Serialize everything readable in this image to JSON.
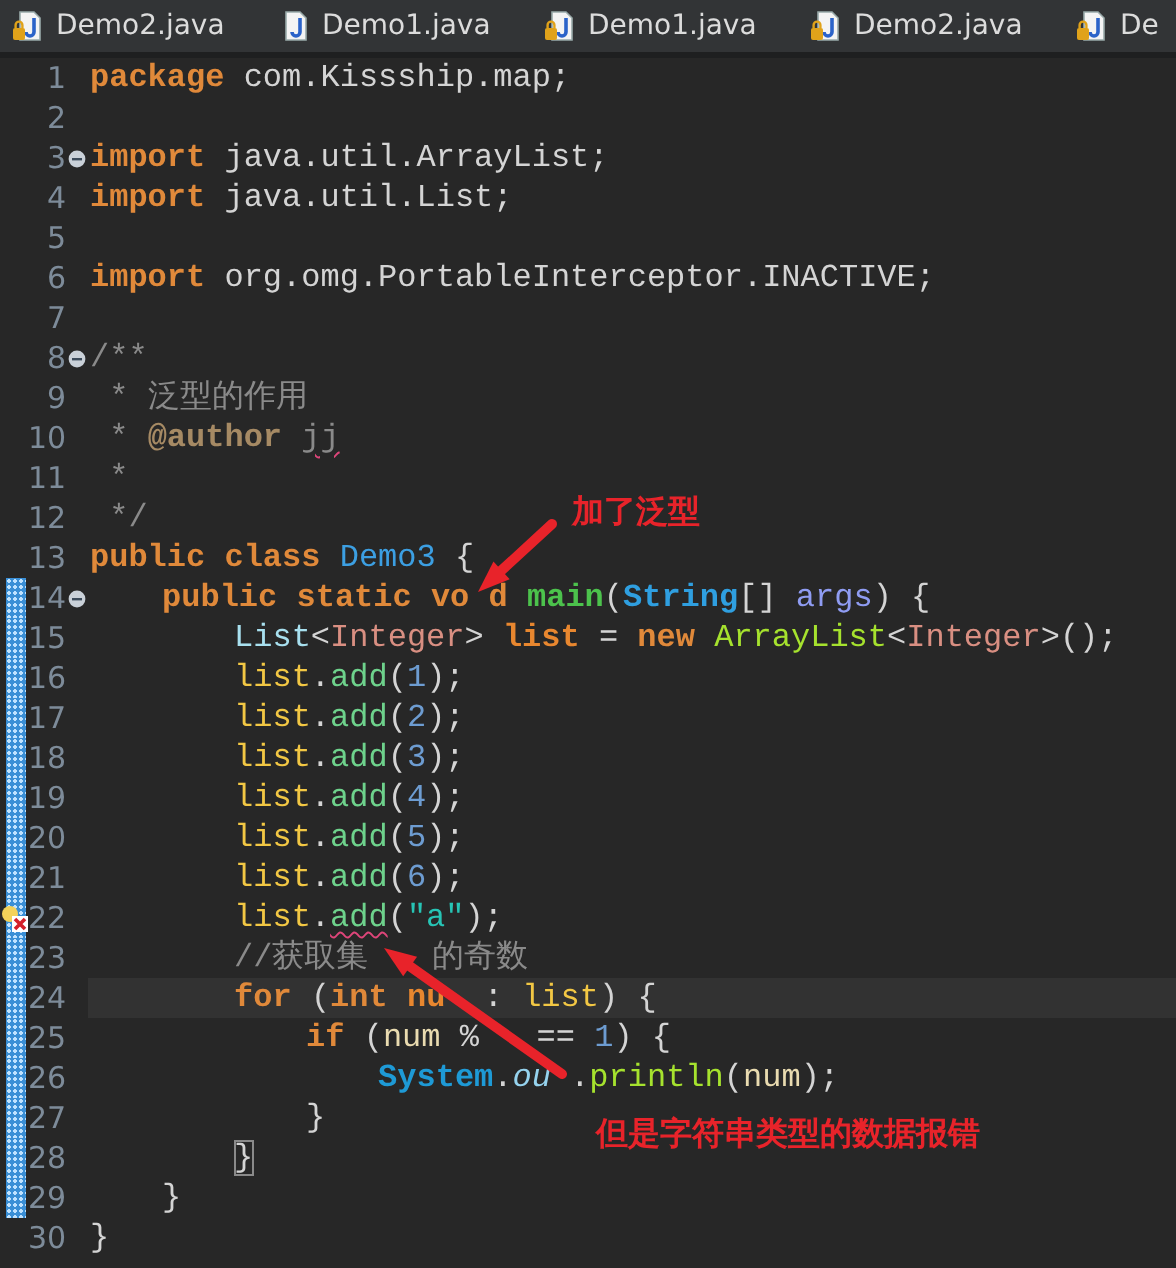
{
  "tabs": [
    {
      "label": "Demo2.java",
      "locked": true
    },
    {
      "label": "Demo1.java",
      "locked": false
    },
    {
      "label": "Demo1.java",
      "locked": true
    },
    {
      "label": "Demo2.java",
      "locked": true
    },
    {
      "label": "De",
      "locked": true
    }
  ],
  "editor": {
    "lines": [
      {
        "number": "1",
        "tokens": [
          {
            "kind": "keyword",
            "text": "package"
          },
          {
            "kind": "plain",
            "text": " com.Kissship.map;"
          }
        ]
      },
      {
        "number": "2"
      },
      {
        "number": "3",
        "fold": true,
        "tokens": [
          {
            "kind": "keyword",
            "text": "import"
          },
          {
            "kind": "plain",
            "text": " java.util.ArrayList;"
          }
        ]
      },
      {
        "number": "4",
        "tokens": [
          {
            "kind": "keyword",
            "text": "import"
          },
          {
            "kind": "plain",
            "text": " java.util.List;"
          }
        ]
      },
      {
        "number": "5"
      },
      {
        "number": "6",
        "tokens": [
          {
            "kind": "keyword",
            "text": "import"
          },
          {
            "kind": "plain",
            "text": " org.omg.PortableInterceptor.INACTIVE;"
          }
        ]
      },
      {
        "number": "7"
      },
      {
        "number": "8",
        "fold": true,
        "tokens": [
          {
            "kind": "doc",
            "text": "/**"
          }
        ]
      },
      {
        "number": "9",
        "tokens": [
          {
            "kind": "doc",
            "text": " * 泛型的作用"
          }
        ]
      },
      {
        "number": "10",
        "tokens": [
          {
            "kind": "doc",
            "text": " * "
          },
          {
            "kind": "doctag",
            "text": "@author "
          },
          {
            "kind": "doc",
            "text": "jj",
            "squiggle": true
          }
        ]
      },
      {
        "number": "11",
        "tokens": [
          {
            "kind": "doc",
            "text": " *"
          }
        ]
      },
      {
        "number": "12",
        "tokens": [
          {
            "kind": "doc",
            "text": " */"
          }
        ]
      },
      {
        "number": "13",
        "tokens": [
          {
            "kind": "keyword",
            "text": "public"
          },
          {
            "kind": "keyword",
            "text": " class"
          },
          {
            "kind": "class",
            "text": " Demo3"
          },
          {
            "kind": "plain",
            "text": " {"
          }
        ]
      },
      {
        "number": "14",
        "fold": true,
        "changed": true,
        "tokens": [
          {
            "kind": "keyword",
            "text": "\tpublic"
          },
          {
            "kind": "keyword",
            "text": " static"
          },
          {
            "kind": "keyword",
            "text": " vo"
          },
          {
            "kind": "keyword",
            "text": " d"
          },
          {
            "kind": "method-decl",
            "text": " main"
          },
          {
            "kind": "plain",
            "text": "("
          },
          {
            "kind": "type",
            "text": "String"
          },
          {
            "kind": "plain",
            "text": "[] "
          },
          {
            "kind": "param",
            "text": "args"
          },
          {
            "kind": "plain",
            "text": ") {"
          }
        ]
      },
      {
        "number": "15",
        "changed": true,
        "tokens": [
          {
            "kind": "interface",
            "text": "\t\tList"
          },
          {
            "kind": "plain",
            "text": "<"
          },
          {
            "kind": "generic",
            "text": "Integer"
          },
          {
            "kind": "plain",
            "text": "> "
          },
          {
            "kind": "local-decl",
            "text": "list"
          },
          {
            "kind": "plain",
            "text": " = "
          },
          {
            "kind": "keyword",
            "text": "new"
          },
          {
            "kind": "constructor",
            "text": " ArrayList"
          },
          {
            "kind": "plain",
            "text": "<"
          },
          {
            "kind": "generic",
            "text": "Integer"
          },
          {
            "kind": "plain",
            "text": ">();"
          }
        ]
      },
      {
        "number": "16",
        "changed": true,
        "tokens": [
          {
            "kind": "local",
            "text": "\t\tlist"
          },
          {
            "kind": "plain",
            "text": "."
          },
          {
            "kind": "method",
            "text": "add"
          },
          {
            "kind": "plain",
            "text": "("
          },
          {
            "kind": "number",
            "text": "1"
          },
          {
            "kind": "plain",
            "text": ");"
          }
        ]
      },
      {
        "number": "17",
        "changed": true,
        "tokens": [
          {
            "kind": "local",
            "text": "\t\tlist"
          },
          {
            "kind": "plain",
            "text": "."
          },
          {
            "kind": "method",
            "text": "add"
          },
          {
            "kind": "plain",
            "text": "("
          },
          {
            "kind": "number",
            "text": "2"
          },
          {
            "kind": "plain",
            "text": ");"
          }
        ]
      },
      {
        "number": "18",
        "changed": true,
        "tokens": [
          {
            "kind": "local",
            "text": "\t\tlist"
          },
          {
            "kind": "plain",
            "text": "."
          },
          {
            "kind": "method",
            "text": "add"
          },
          {
            "kind": "plain",
            "text": "("
          },
          {
            "kind": "number",
            "text": "3"
          },
          {
            "kind": "plain",
            "text": ");"
          }
        ]
      },
      {
        "number": "19",
        "changed": true,
        "tokens": [
          {
            "kind": "local",
            "text": "\t\tlist"
          },
          {
            "kind": "plain",
            "text": "."
          },
          {
            "kind": "method",
            "text": "add"
          },
          {
            "kind": "plain",
            "text": "("
          },
          {
            "kind": "number",
            "text": "4"
          },
          {
            "kind": "plain",
            "text": ");"
          }
        ]
      },
      {
        "number": "20",
        "changed": true,
        "tokens": [
          {
            "kind": "local",
            "text": "\t\tlist"
          },
          {
            "kind": "plain",
            "text": "."
          },
          {
            "kind": "method",
            "text": "add"
          },
          {
            "kind": "plain",
            "text": "("
          },
          {
            "kind": "number",
            "text": "5"
          },
          {
            "kind": "plain",
            "text": ");"
          }
        ]
      },
      {
        "number": "21",
        "changed": true,
        "tokens": [
          {
            "kind": "local",
            "text": "\t\tlist"
          },
          {
            "kind": "plain",
            "text": "."
          },
          {
            "kind": "method",
            "text": "add"
          },
          {
            "kind": "plain",
            "text": "("
          },
          {
            "kind": "number",
            "text": "6"
          },
          {
            "kind": "plain",
            "text": ");"
          }
        ]
      },
      {
        "number": "22",
        "changed": true,
        "error": true,
        "tokens": [
          {
            "kind": "local",
            "text": "\t\tlist"
          },
          {
            "kind": "plain",
            "text": "."
          },
          {
            "kind": "method",
            "text": "add",
            "squiggle": true
          },
          {
            "kind": "plain",
            "text": "("
          },
          {
            "kind": "string",
            "text": "\"a\""
          },
          {
            "kind": "plain",
            "text": ");"
          }
        ]
      },
      {
        "number": "23",
        "changed": true,
        "tokens": [
          {
            "kind": "comment",
            "text": "\t\t//获取集"
          },
          {
            "kind": "comment",
            "text": "　　的奇数"
          }
        ]
      },
      {
        "number": "24",
        "changed": true,
        "current": true,
        "tokens": [
          {
            "kind": "keyword",
            "text": "\t\tfor"
          },
          {
            "kind": "plain",
            "text": " ("
          },
          {
            "kind": "keyword",
            "text": "int"
          },
          {
            "kind": "local-decl",
            "text": " nu"
          },
          {
            "kind": "plain",
            "text": "  : "
          },
          {
            "kind": "local",
            "text": "list"
          },
          {
            "kind": "plain",
            "text": ") {"
          }
        ]
      },
      {
        "number": "25",
        "changed": true,
        "tokens": [
          {
            "kind": "keyword",
            "text": "\t\t\tif"
          },
          {
            "kind": "plain",
            "text": " ("
          },
          {
            "kind": "variable",
            "text": "num"
          },
          {
            "kind": "plain",
            "text": " %   == "
          },
          {
            "kind": "number",
            "text": "1"
          },
          {
            "kind": "plain",
            "text": ") {"
          }
        ]
      },
      {
        "number": "26",
        "changed": true,
        "tokens": [
          {
            "kind": "static",
            "text": "\t\t\t\tSystem"
          },
          {
            "kind": "plain",
            "text": "."
          },
          {
            "kind": "field",
            "text": "ou"
          },
          {
            "kind": "plain",
            "text": " ."
          },
          {
            "kind": "call",
            "text": "println"
          },
          {
            "kind": "plain",
            "text": "("
          },
          {
            "kind": "variable",
            "text": "num"
          },
          {
            "kind": "plain",
            "text": ");"
          }
        ]
      },
      {
        "number": "27",
        "changed": true,
        "tokens": [
          {
            "kind": "plain",
            "text": "\t\t\t}"
          }
        ]
      },
      {
        "number": "28",
        "changed": true,
        "tokens": [
          {
            "kind": "plain",
            "text": "\t\t}",
            "matched": true
          }
        ]
      },
      {
        "number": "29",
        "changed": true,
        "tokens": [
          {
            "kind": "plain",
            "text": "\t}"
          }
        ]
      },
      {
        "number": "30",
        "tokens": [
          {
            "kind": "plain",
            "text": "}"
          }
        ]
      }
    ]
  },
  "annotations": [
    {
      "kind": "callout",
      "text": "加了泛型"
    },
    {
      "kind": "callout",
      "text": "但是字符串类型的数据报错"
    }
  ]
}
